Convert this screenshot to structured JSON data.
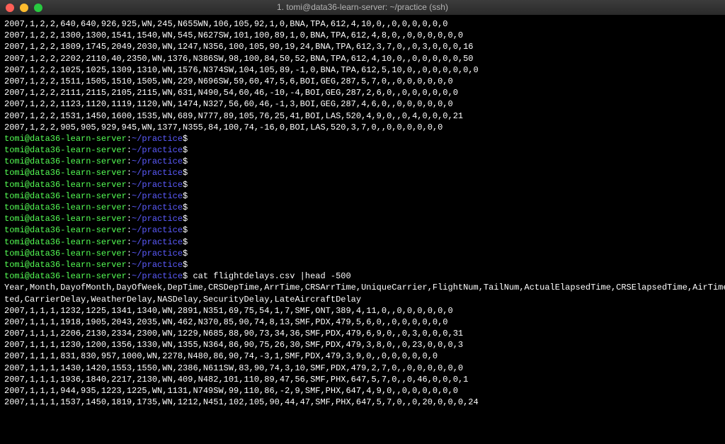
{
  "window": {
    "title": "1. tomi@data36-learn-server: ~/practice (ssh)"
  },
  "prompt": {
    "user_host": "tomi@data36-learn-server",
    "path": "~/practice",
    "separator": ":",
    "symbol": "$"
  },
  "data_lines_top": [
    "2007,1,2,2,640,640,926,925,WN,245,N655WN,106,105,92,1,0,BNA,TPA,612,4,10,0,,0,0,0,0,0,0",
    "2007,1,2,2,1300,1300,1541,1540,WN,545,N627SW,101,100,89,1,0,BNA,TPA,612,4,8,0,,0,0,0,0,0,0",
    "2007,1,2,2,1809,1745,2049,2030,WN,1247,N356,100,105,90,19,24,BNA,TPA,612,3,7,0,,0,3,0,0,0,16",
    "2007,1,2,2,2202,2110,40,2350,WN,1376,N386SW,98,100,84,50,52,BNA,TPA,612,4,10,0,,0,0,0,0,0,50",
    "2007,1,2,2,1025,1025,1309,1310,WN,1576,N374SW,104,105,89,-1,0,BNA,TPA,612,5,10,0,,0,0,0,0,0,0",
    "2007,1,2,2,1511,1505,1510,1505,WN,229,N696SW,59,60,47,5,6,BOI,GEG,287,5,7,0,,0,0,0,0,0,0",
    "2007,1,2,2,2111,2115,2105,2115,WN,631,N490,54,60,46,-10,-4,BOI,GEG,287,2,6,0,,0,0,0,0,0,0",
    "2007,1,2,2,1123,1120,1119,1120,WN,1474,N327,56,60,46,-1,3,BOI,GEG,287,4,6,0,,0,0,0,0,0,0",
    "2007,1,2,2,1531,1450,1600,1535,WN,689,N777,89,105,76,25,41,BOI,LAS,520,4,9,0,,0,4,0,0,0,21",
    "2007,1,2,2,905,905,929,945,WN,1377,N355,84,100,74,-16,0,BOI,LAS,520,3,7,0,,0,0,0,0,0,0"
  ],
  "empty_prompts_count": 12,
  "command": "cat flightdelays.csv |head -500",
  "header_lines": [
    "Year,Month,DayofMonth,DayOfWeek,DepTime,CRSDepTime,ArrTime,CRSArrTime,UniqueCarrier,FlightNum,TailNum,ActualElapsedTime,CRSElapsedTime,AirTime,",
    "ted,CarrierDelay,WeatherDelay,NASDelay,SecurityDelay,LateAircraftDelay"
  ],
  "data_lines_bottom": [
    "2007,1,1,1,1232,1225,1341,1340,WN,2891,N351,69,75,54,1,7,SMF,ONT,389,4,11,0,,0,0,0,0,0,0",
    "2007,1,1,1,1918,1905,2043,2035,WN,462,N370,85,90,74,8,13,SMF,PDX,479,5,6,0,,0,0,0,0,0,0",
    "2007,1,1,1,2206,2130,2334,2300,WN,1229,N685,88,90,73,34,36,SMF,PDX,479,6,9,0,,0,3,0,0,0,31",
    "2007,1,1,1,1230,1200,1356,1330,WN,1355,N364,86,90,75,26,30,SMF,PDX,479,3,8,0,,0,23,0,0,0,3",
    "2007,1,1,1,831,830,957,1000,WN,2278,N480,86,90,74,-3,1,SMF,PDX,479,3,9,0,,0,0,0,0,0,0",
    "2007,1,1,1,1430,1420,1553,1550,WN,2386,N611SW,83,90,74,3,10,SMF,PDX,479,2,7,0,,0,0,0,0,0,0",
    "2007,1,1,1,1936,1840,2217,2130,WN,409,N482,101,110,89,47,56,SMF,PHX,647,5,7,0,,0,46,0,0,0,1",
    "2007,1,1,1,944,935,1223,1225,WN,1131,N749SW,99,110,86,-2,9,SMF,PHX,647,4,9,0,,0,0,0,0,0,0",
    "2007,1,1,1,1537,1450,1819,1735,WN,1212,N451,102,105,90,44,47,SMF,PHX,647,5,7,0,,0,20,0,0,0,24"
  ]
}
